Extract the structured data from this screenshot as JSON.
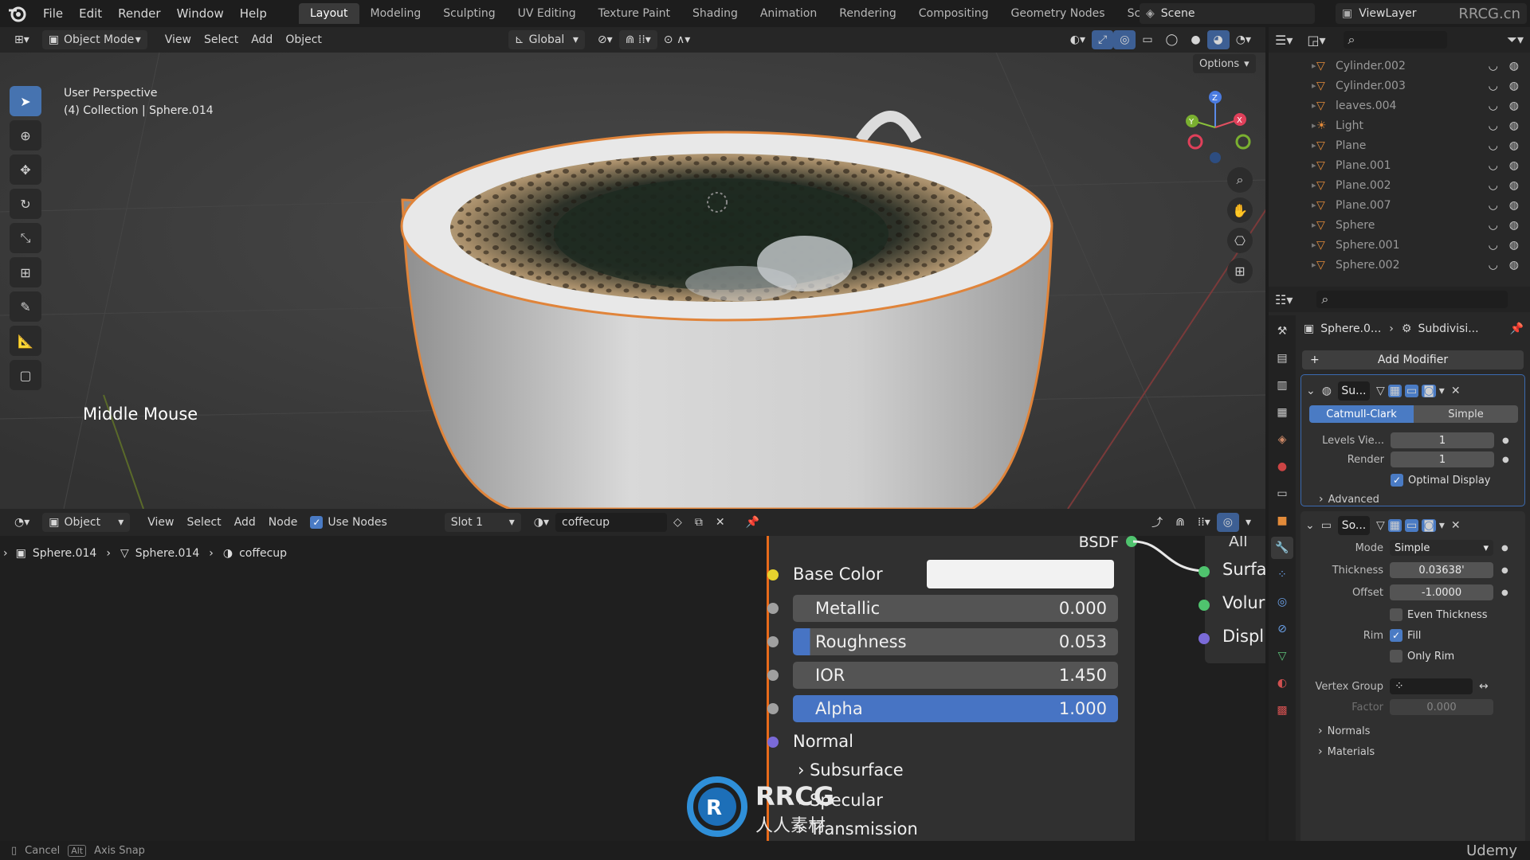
{
  "top_menu": [
    "File",
    "Edit",
    "Render",
    "Window",
    "Help"
  ],
  "workspaces": [
    "Layout",
    "Modeling",
    "Sculpting",
    "UV Editing",
    "Texture Paint",
    "Shading",
    "Animation",
    "Rendering",
    "Compositing",
    "Geometry Nodes",
    "Scripting"
  ],
  "active_workspace": "Layout",
  "scene": "Scene",
  "view_layer": "ViewLayer",
  "watermark_top": "RRCG.cn",
  "viewport": {
    "mode": "Object Mode",
    "menus": [
      "View",
      "Select",
      "Add",
      "Object"
    ],
    "transform_orientation": "Global",
    "options": "Options",
    "info_line1": "User Perspective",
    "info_line2": "(4) Collection | Sphere.014",
    "overlay_text": "Middle Mouse"
  },
  "outliner": {
    "rows": [
      {
        "name": "Cylinder.002",
        "icon": "mesh-icon"
      },
      {
        "name": "Cylinder.003",
        "icon": "mesh-icon"
      },
      {
        "name": "leaves.004",
        "icon": "mesh-icon"
      },
      {
        "name": "Light",
        "icon": "light-icon"
      },
      {
        "name": "Plane",
        "icon": "mesh-icon"
      },
      {
        "name": "Plane.001",
        "icon": "mesh-icon"
      },
      {
        "name": "Plane.002",
        "icon": "mesh-icon"
      },
      {
        "name": "Plane.007",
        "icon": "mesh-icon"
      },
      {
        "name": "Sphere",
        "icon": "mesh-icon"
      },
      {
        "name": "Sphere.001",
        "icon": "mesh-icon"
      },
      {
        "name": "Sphere.002",
        "icon": "mesh-icon"
      }
    ]
  },
  "properties": {
    "breadcrumb_object": "Sphere.0...",
    "breadcrumb_modifier": "Subdivisi...",
    "add_modifier": "Add Modifier",
    "subdiv": {
      "name": "Su...",
      "method_a": "Catmull-Clark",
      "method_b": "Simple",
      "levels_label": "Levels Vie...",
      "levels_value": "1",
      "render_label": "Render",
      "render_value": "1",
      "optimal_display": "Optimal Display",
      "advanced": "Advanced"
    },
    "solidify": {
      "name": "So...",
      "mode_label": "Mode",
      "mode_value": "Simple",
      "thickness_label": "Thickness",
      "thickness_value": "0.03638'",
      "offset_label": "Offset",
      "offset_value": "-1.0000",
      "even_thickness": "Even Thickness",
      "rim_label": "Rim",
      "fill": "Fill",
      "only_rim": "Only Rim",
      "vertex_group_label": "Vertex Group",
      "factor_label": "Factor",
      "factor_value": "0.000",
      "normals": "Normals",
      "materials": "Materials"
    }
  },
  "node_editor": {
    "mode": "Object",
    "menus": [
      "View",
      "Select",
      "Add",
      "Node"
    ],
    "use_nodes": "Use Nodes",
    "slot": "Slot 1",
    "material": "coffecup",
    "crumbs": [
      "Sphere.014",
      "Sphere.014",
      "coffecup"
    ],
    "bsdf_title": "BSDF",
    "all_label": "All",
    "base_color": "Base Color",
    "metallic_label": "Metallic",
    "metallic_value": "0.000",
    "roughness_label": "Roughness",
    "roughness_value": "0.053",
    "ior_label": "IOR",
    "ior_value": "1.450",
    "alpha_label": "Alpha",
    "alpha_value": "1.000",
    "normal": "Normal",
    "subsurface": "Subsurface",
    "specular": "Specular",
    "transmission": "Transmission",
    "output_surface": "Surfa",
    "output_volume": "Volur",
    "output_displacement": "Displ"
  },
  "statusbar": {
    "cancel": "Cancel",
    "alt": "Alt",
    "axis_snap": "Axis Snap"
  },
  "watermark": {
    "main": "RRCG",
    "sub": "人人素材",
    "udemy": "Udemy"
  }
}
